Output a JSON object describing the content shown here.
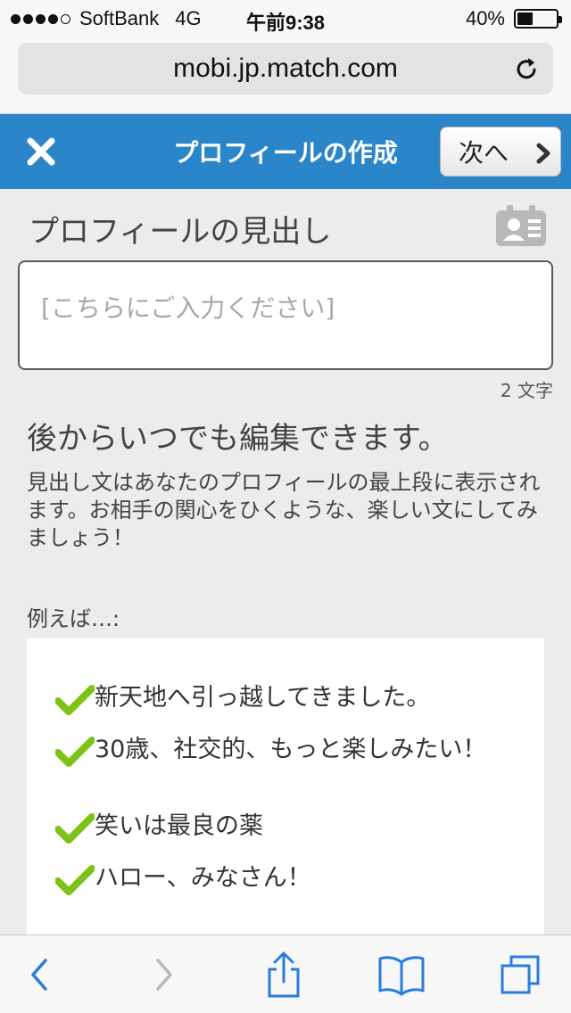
{
  "status_bar": {
    "carrier": "SoftBank",
    "network": "4G",
    "time": "午前9:38",
    "battery_text": "40%",
    "battery_level": 0.4,
    "signal_bars": 4
  },
  "browser": {
    "url": "mobi.jp.match.com"
  },
  "header": {
    "title": "プロフィールの作成",
    "next_label": "次へ",
    "accent_color": "#2a86c9"
  },
  "main": {
    "section_title": "プロフィールの見出し",
    "input_placeholder": "[こちらにご入力ください]",
    "char_count": "2 文字",
    "edit_note": "後からいつでも編集できます。",
    "description": "見出し文はあなたのプロフィールの最上段に表示されます。お相手の関心をひくような、楽しい文にしてみましょう！",
    "examples_label": "例えば…:",
    "examples": [
      "新天地へ引っ越してきました。",
      "30歳、社交的、もっと楽しみたい！",
      "笑いは最良の薬",
      "ハロー、みなさん！"
    ],
    "check_color": "#7cc318"
  },
  "icons": {
    "close": "close-icon",
    "next": "chevron-right-icon",
    "reload": "reload-icon",
    "profile_card": "profile-card-icon",
    "check": "check-icon",
    "back": "back-icon",
    "forward": "forward-icon",
    "share": "share-icon",
    "bookmarks": "bookmarks-icon",
    "tabs": "tabs-icon"
  }
}
